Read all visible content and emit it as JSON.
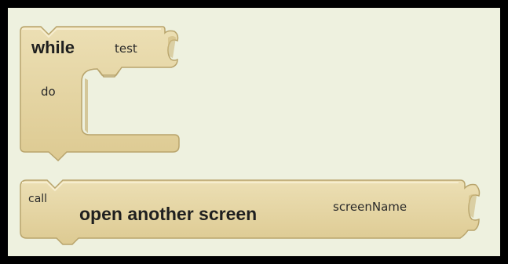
{
  "colors": {
    "workspace_bg": "#eef1df",
    "frame_border": "#000000",
    "block_fill": "#e3d3a0",
    "block_highlight": "#f3e8c4",
    "block_shadow": "#b39d5f",
    "text": "#1f1f1f"
  },
  "while_block": {
    "keyword": "while",
    "test_label": "test",
    "do_label": "do"
  },
  "call_block": {
    "prefix": "call",
    "procedure_name": "open another screen",
    "param_label": "screenName"
  }
}
